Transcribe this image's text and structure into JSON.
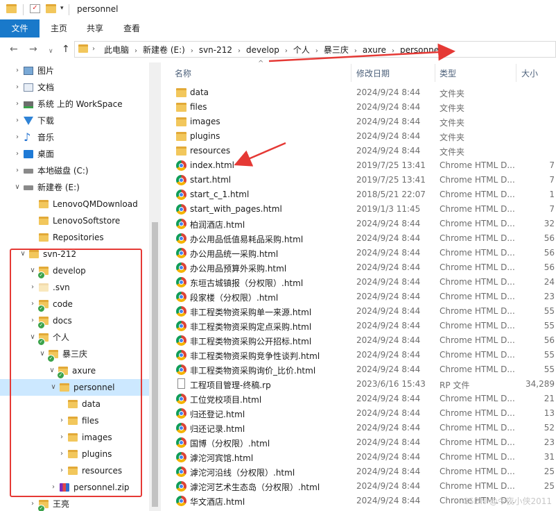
{
  "window": {
    "title": "personnel",
    "qat_arrow": "▾"
  },
  "ribbon": {
    "tabs": [
      "文件",
      "主页",
      "共享",
      "查看"
    ]
  },
  "nav": {
    "back": "←",
    "forward": "→",
    "recent": "∨",
    "up": "↑"
  },
  "address": {
    "crumbs": [
      "此电脑",
      "新建卷 (E:)",
      "svn-212",
      "develop",
      "个人",
      "暴三庆",
      "axure",
      "personnel"
    ],
    "separator": "›",
    "leading_arrow": "›",
    "trailing_arrow": "›"
  },
  "tree": [
    {
      "label": "图片",
      "icon": "pictures-icon",
      "chevron": "›"
    },
    {
      "label": "文档",
      "icon": "documents-icon",
      "chevron": "›"
    },
    {
      "label": "系统 上的 WorkSpace",
      "icon": "network-drive-icon",
      "chevron": "›"
    },
    {
      "label": "下载",
      "icon": "download-icon",
      "chevron": "›"
    },
    {
      "label": "音乐",
      "icon": "music-icon",
      "chevron": "›"
    },
    {
      "label": "桌面",
      "icon": "desktop-icon",
      "chevron": "›"
    },
    {
      "label": "本地磁盘 (C:)",
      "icon": "drive-icon",
      "chevron": "›"
    },
    {
      "label": "新建卷 (E:)",
      "icon": "drive-icon",
      "chevron": "∨"
    },
    {
      "label": "LenovoQMDownload",
      "icon": "folder-icon",
      "chevron": ""
    },
    {
      "label": "LenovoSoftstore",
      "icon": "folder-icon",
      "chevron": ""
    },
    {
      "label": "Repositories",
      "icon": "folder-icon",
      "chevron": ""
    },
    {
      "label": "svn-212",
      "icon": "folder-icon",
      "chevron": "∨"
    },
    {
      "label": "develop",
      "icon": "svn-folder-icon",
      "chevron": "∨"
    },
    {
      "label": ".svn",
      "icon": "hidden-folder-icon",
      "chevron": "›"
    },
    {
      "label": "code",
      "icon": "svn-folder-icon",
      "chevron": "›"
    },
    {
      "label": "docs",
      "icon": "svn-folder-icon",
      "chevron": "›"
    },
    {
      "label": "个人",
      "icon": "svn-folder-icon",
      "chevron": "∨"
    },
    {
      "label": "暴三庆",
      "icon": "svn-folder-icon",
      "chevron": "∨"
    },
    {
      "label": "axure",
      "icon": "svn-folder-icon",
      "chevron": "∨"
    },
    {
      "label": "personnel",
      "icon": "folder-icon",
      "chevron": "∨"
    },
    {
      "label": "data",
      "icon": "folder-icon",
      "chevron": ""
    },
    {
      "label": "files",
      "icon": "folder-icon",
      "chevron": "›"
    },
    {
      "label": "images",
      "icon": "folder-icon",
      "chevron": "›"
    },
    {
      "label": "plugins",
      "icon": "folder-icon",
      "chevron": "›"
    },
    {
      "label": "resources",
      "icon": "folder-icon",
      "chevron": "›"
    },
    {
      "label": "personnel.zip",
      "icon": "zip-icon",
      "chevron": "›"
    },
    {
      "label": "王亮",
      "icon": "svn-folder-icon",
      "chevron": "›"
    }
  ],
  "columns": {
    "name": "名称",
    "date": "修改日期",
    "type": "类型",
    "size": "大小"
  },
  "files": [
    {
      "name": "data",
      "date": "2024/9/24 8:44",
      "type": "文件夹",
      "size": "",
      "icon": "folder-icon"
    },
    {
      "name": "files",
      "date": "2024/9/24 8:44",
      "type": "文件夹",
      "size": "",
      "icon": "folder-icon"
    },
    {
      "name": "images",
      "date": "2024/9/24 8:44",
      "type": "文件夹",
      "size": "",
      "icon": "folder-icon"
    },
    {
      "name": "plugins",
      "date": "2024/9/24 8:44",
      "type": "文件夹",
      "size": "",
      "icon": "folder-icon"
    },
    {
      "name": "resources",
      "date": "2024/9/24 8:44",
      "type": "文件夹",
      "size": "",
      "icon": "folder-icon"
    },
    {
      "name": "index.html",
      "date": "2019/7/25 13:41",
      "type": "Chrome HTML D...",
      "size": "7",
      "icon": "chrome-icon"
    },
    {
      "name": "start.html",
      "date": "2019/7/25 13:41",
      "type": "Chrome HTML D...",
      "size": "7",
      "icon": "chrome-icon"
    },
    {
      "name": "start_c_1.html",
      "date": "2018/5/21 22:07",
      "type": "Chrome HTML D...",
      "size": "1",
      "icon": "chrome-icon"
    },
    {
      "name": "start_with_pages.html",
      "date": "2019/1/3 11:45",
      "type": "Chrome HTML D...",
      "size": "7",
      "icon": "chrome-icon"
    },
    {
      "name": "柏润酒店.html",
      "date": "2024/9/24 8:44",
      "type": "Chrome HTML D...",
      "size": "32",
      "icon": "chrome-icon"
    },
    {
      "name": "办公用品低值易耗品采购.html",
      "date": "2024/9/24 8:44",
      "type": "Chrome HTML D...",
      "size": "56",
      "icon": "chrome-icon"
    },
    {
      "name": "办公用品统一采购.html",
      "date": "2024/9/24 8:44",
      "type": "Chrome HTML D...",
      "size": "56",
      "icon": "chrome-icon"
    },
    {
      "name": "办公用品预算外采购.html",
      "date": "2024/9/24 8:44",
      "type": "Chrome HTML D...",
      "size": "56",
      "icon": "chrome-icon"
    },
    {
      "name": "东垣古城镇报（分权限）.html",
      "date": "2024/9/24 8:44",
      "type": "Chrome HTML D...",
      "size": "24",
      "icon": "chrome-icon"
    },
    {
      "name": "段家楼（分权限）.html",
      "date": "2024/9/24 8:44",
      "type": "Chrome HTML D...",
      "size": "23",
      "icon": "chrome-icon"
    },
    {
      "name": "非工程类物资采购单一来源.html",
      "date": "2024/9/24 8:44",
      "type": "Chrome HTML D...",
      "size": "55",
      "icon": "chrome-icon"
    },
    {
      "name": "非工程类物资采购定点采购.html",
      "date": "2024/9/24 8:44",
      "type": "Chrome HTML D...",
      "size": "55",
      "icon": "chrome-icon"
    },
    {
      "name": "非工程类物资采购公开招标.html",
      "date": "2024/9/24 8:44",
      "type": "Chrome HTML D...",
      "size": "56",
      "icon": "chrome-icon"
    },
    {
      "name": "非工程类物资采购竞争性谈判.html",
      "date": "2024/9/24 8:44",
      "type": "Chrome HTML D...",
      "size": "55",
      "icon": "chrome-icon"
    },
    {
      "name": "非工程类物资采购询价_比价.html",
      "date": "2024/9/24 8:44",
      "type": "Chrome HTML D...",
      "size": "55",
      "icon": "chrome-icon"
    },
    {
      "name": "工程项目管理-终稿.rp",
      "date": "2023/6/16 15:43",
      "type": "RP 文件",
      "size": "34,289",
      "icon": "rp-file-icon"
    },
    {
      "name": "工位党校项目.html",
      "date": "2024/9/24 8:44",
      "type": "Chrome HTML D...",
      "size": "21",
      "icon": "chrome-icon"
    },
    {
      "name": "归还登记.html",
      "date": "2024/9/24 8:44",
      "type": "Chrome HTML D...",
      "size": "13",
      "icon": "chrome-icon"
    },
    {
      "name": "归还记录.html",
      "date": "2024/9/24 8:44",
      "type": "Chrome HTML D...",
      "size": "52",
      "icon": "chrome-icon"
    },
    {
      "name": "国博（分权限）.html",
      "date": "2024/9/24 8:44",
      "type": "Chrome HTML D...",
      "size": "23",
      "icon": "chrome-icon"
    },
    {
      "name": "滹沱河宾馆.html",
      "date": "2024/9/24 8:44",
      "type": "Chrome HTML D...",
      "size": "31",
      "icon": "chrome-icon"
    },
    {
      "name": "滹沱河沿线（分权限）.html",
      "date": "2024/9/24 8:44",
      "type": "Chrome HTML D...",
      "size": "25",
      "icon": "chrome-icon"
    },
    {
      "name": "滹沱河艺术生态岛（分权限）.html",
      "date": "2024/9/24 8:44",
      "type": "Chrome HTML D...",
      "size": "25",
      "icon": "chrome-icon"
    },
    {
      "name": "华文酒店.html",
      "date": "2024/9/24 8:44",
      "type": "Chrome HTML D...",
      "size": "",
      "icon": "chrome-icon"
    }
  ],
  "watermark": "CSDN @今夜小侠2011",
  "colors": {
    "accent": "#1979ca",
    "selection": "#cce8ff",
    "annotation_red": "#e53935"
  }
}
